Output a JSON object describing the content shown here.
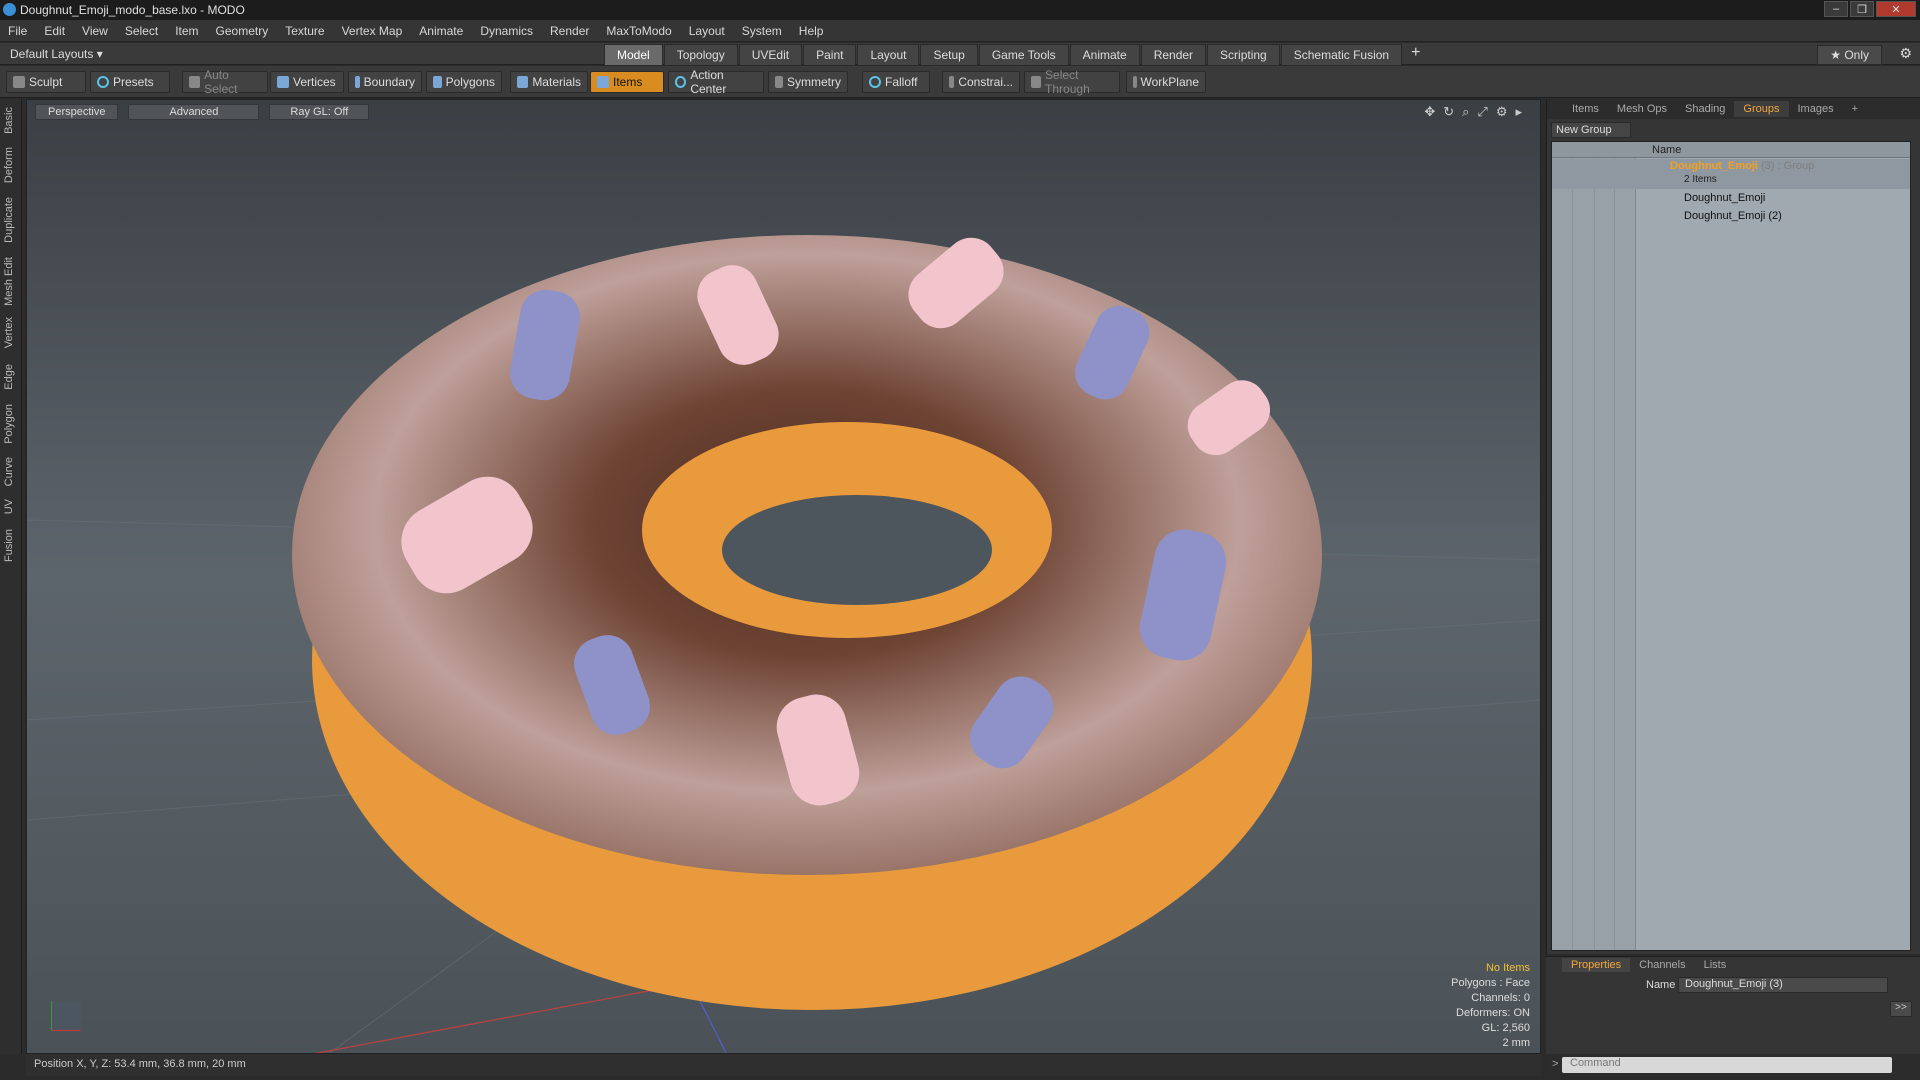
{
  "window": {
    "title": "Doughnut_Emoji_modo_base.lxo - MODO"
  },
  "menu": [
    "File",
    "Edit",
    "View",
    "Select",
    "Item",
    "Geometry",
    "Texture",
    "Vertex Map",
    "Animate",
    "Dynamics",
    "Render",
    "MaxToModo",
    "Layout",
    "System",
    "Help"
  ],
  "layoutbar": {
    "default_layouts": "Default Layouts ▾",
    "tabs": [
      "Model",
      "Topology",
      "UVEdit",
      "Paint",
      "Layout",
      "Setup",
      "Game Tools",
      "Animate",
      "Render",
      "Scripting",
      "Schematic Fusion"
    ],
    "active_tab": "Model",
    "only_label": "★ Only"
  },
  "toolbar": {
    "sculpt": "Sculpt",
    "presets": "Presets",
    "auto_select": "Auto Select",
    "vertices": "Vertices",
    "boundary": "Boundary",
    "polygons": "Polygons",
    "materials": "Materials",
    "items": "Items",
    "action_center": "Action Center",
    "symmetry": "Symmetry",
    "falloff": "Falloff",
    "constraints": "Constrai...",
    "select_through": "Select Through",
    "workplane": "WorkPlane"
  },
  "lefttabs": [
    "Basic",
    "Deform",
    "Duplicate",
    "Mesh Edit",
    "Vertex",
    "Edge",
    "Polygon",
    "Curve",
    "UV",
    "Fusion"
  ],
  "viewport": {
    "perspective": "Perspective",
    "advanced": "Advanced",
    "raygl": "Ray GL: Off",
    "info": {
      "no_items": "No Items",
      "polygons": "Polygons : Face",
      "channels": "Channels: 0",
      "deformers": "Deformers: ON",
      "gl": "GL: 2,560",
      "scale": "2 mm"
    }
  },
  "status": {
    "position": "Position X, Y, Z:   53.4 mm, 36.8 mm, 20 mm"
  },
  "groups_panel": {
    "tabs": [
      "Items",
      "Mesh Ops",
      "Shading",
      "Groups",
      "Images"
    ],
    "active_tab": "Groups",
    "new_group": "New Group",
    "name_header": "Name",
    "group_name": "Doughnut_Emoji",
    "group_suffix": " (3) : Group",
    "item_count": "2 Items",
    "children": [
      "Doughnut_Emoji",
      "Doughnut_Emoji (2)"
    ]
  },
  "properties_panel": {
    "tabs": [
      "Properties",
      "Channels",
      "Lists"
    ],
    "active_tab": "Properties",
    "name_label": "Name",
    "name_value": "Doughnut_Emoji (3)",
    "expand_btn": ">>"
  },
  "command": {
    "placeholder": "Command"
  },
  "colors": {
    "accent": "#d98c1f",
    "icing": "#6b3f2e",
    "dough": "#e89a3c",
    "sprinkle_pink": "#f2c4cc",
    "sprinkle_blue": "#8e92c8"
  }
}
